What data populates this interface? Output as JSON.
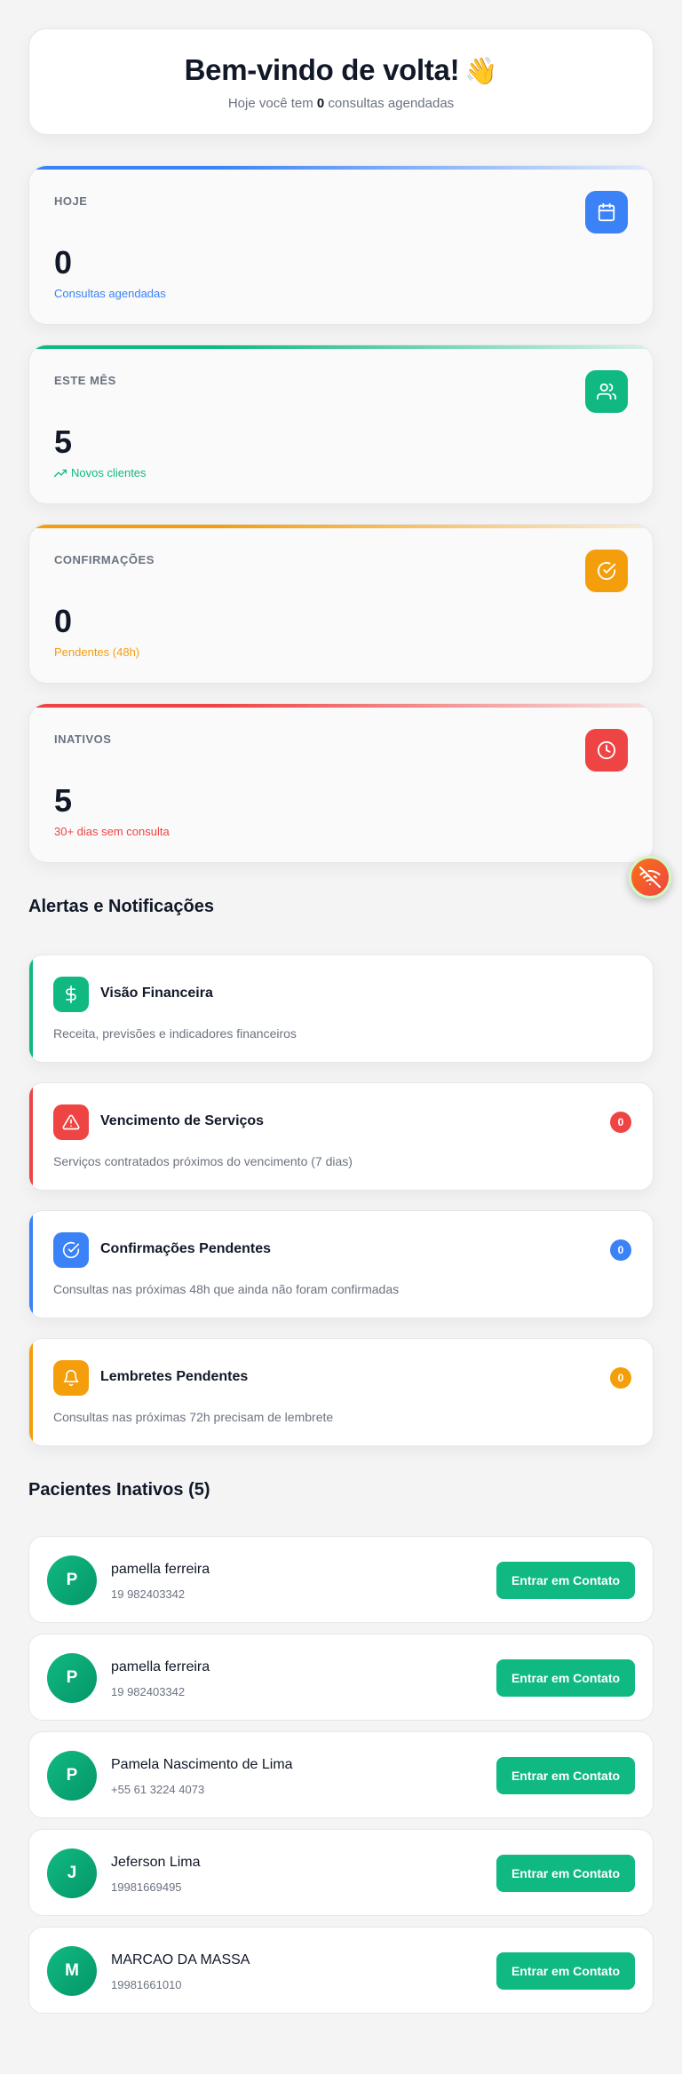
{
  "welcome": {
    "title": "Bem-vindo de volta!",
    "wave_emoji": "👋",
    "subtitle_before": "Hoje você tem",
    "count": "0",
    "subtitle_after": "consultas agendadas"
  },
  "stats": [
    {
      "label": "HOJE",
      "value": "0",
      "sub": "Consultas agendadas",
      "icon": "calendar-icon",
      "color": "#3b82f6"
    },
    {
      "label": "ESTE MÊS",
      "value": "5",
      "sub": "Novos clientes",
      "icon": "users-icon",
      "color": "#10b981"
    },
    {
      "label": "CONFIRMAÇÕES",
      "value": "0",
      "sub": "Pendentes (48h)",
      "icon": "check-circle-icon",
      "color": "#f59e0b"
    },
    {
      "label": "INATIVOS",
      "value": "5",
      "sub": "30+ dias sem consulta",
      "icon": "clock-icon",
      "color": "#ef4444"
    }
  ],
  "alerts_title": "Alertas e Notificações",
  "alerts": [
    {
      "title": "Visão Financeira",
      "desc": "Receita, previsões e indicadores financeiros",
      "icon": "dollar-icon",
      "color": "#10b981"
    },
    {
      "title": "Vencimento de Serviços",
      "desc": "Serviços contratados próximos do vencimento (7 dias)",
      "badge": "0",
      "icon": "warning-icon",
      "color": "#ef4444"
    },
    {
      "title": "Confirmações Pendentes",
      "desc": "Consultas nas próximas 48h que ainda não foram confirmadas",
      "badge": "0",
      "icon": "check-circle-icon",
      "color": "#3b82f6"
    },
    {
      "title": "Lembretes Pendentes",
      "desc": "Consultas nas próximas 72h precisam de lembrete",
      "badge": "0",
      "icon": "bell-icon",
      "color": "#f59e0b"
    }
  ],
  "inactive_title": "Pacientes Inativos (5)",
  "contact_label": "Entrar em Contato",
  "patients": [
    {
      "initial": "P",
      "name": "pamella ferreira",
      "phone": "19 982403342"
    },
    {
      "initial": "P",
      "name": "pamella ferreira",
      "phone": "19 982403342"
    },
    {
      "initial": "P",
      "name": "Pamela Nascimento de Lima",
      "phone": "+55 61 3224 4073"
    },
    {
      "initial": "J",
      "name": "Jeferson Lima",
      "phone": "19981669495"
    },
    {
      "initial": "M",
      "name": "MARCAO DA MASSA",
      "phone": "19981661010"
    }
  ],
  "floating_button": {
    "icon": "wifi-off-icon"
  }
}
